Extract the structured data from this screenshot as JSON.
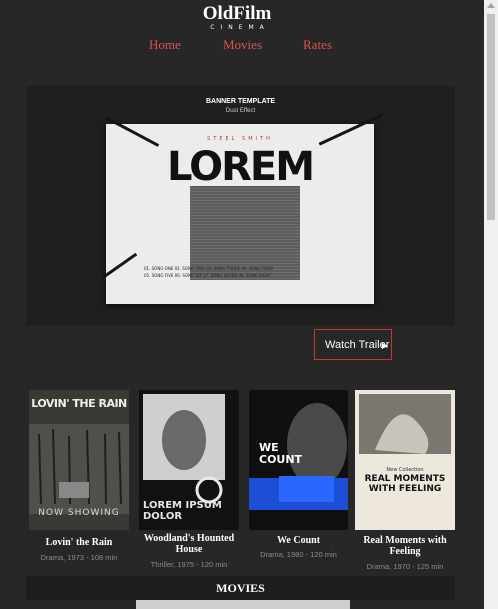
{
  "logo": {
    "title": "OldFilm",
    "subtitle": "CINEMA"
  },
  "nav": [
    {
      "label": "Home"
    },
    {
      "label": "Movies"
    },
    {
      "label": "Rates"
    }
  ],
  "banner": {
    "template_label": "BANNER TEMPLATE",
    "effect_label": "Dust Effect",
    "artist": "STEEL SMITH",
    "headline": "LOREM",
    "songs": [
      "01. SONG ONE  02. SONG TWO  03. SONG THREE  04. SONG FOUR",
      "05. SONG FIVE  06. SONG SIX  07. SONG SEVEN  08. SONG EIGHT"
    ]
  },
  "trailer_button": {
    "label": "Watch Trailer"
  },
  "movies": [
    {
      "title": "Lovin' the Rain",
      "meta": "Drama, 1973 - 108 min",
      "poster_title": "LOVIN' THE RAIN",
      "poster_footer": "NOW SHOWING"
    },
    {
      "title": "Woodland's Hounted House",
      "meta": "Thriller, 1975 - 120 min",
      "poster_title": "LOREM IPSUM DOLOR"
    },
    {
      "title": "We Count",
      "meta": "Drama, 1980 - 120 min",
      "poster_title": "WE COUNT"
    },
    {
      "title": "Real Moments with Feeling",
      "meta": "Drama, 1970 - 125 min",
      "poster_title": "REAL MOMENTS WITH FEELING",
      "poster_kicker": "New Collection"
    }
  ],
  "section": {
    "title": "MOVIES"
  },
  "colors": {
    "accent": "#e0524e",
    "background": "#272727",
    "panel": "#1f1f1f"
  },
  "icons": {
    "trailer": "play-triangle-icon"
  }
}
